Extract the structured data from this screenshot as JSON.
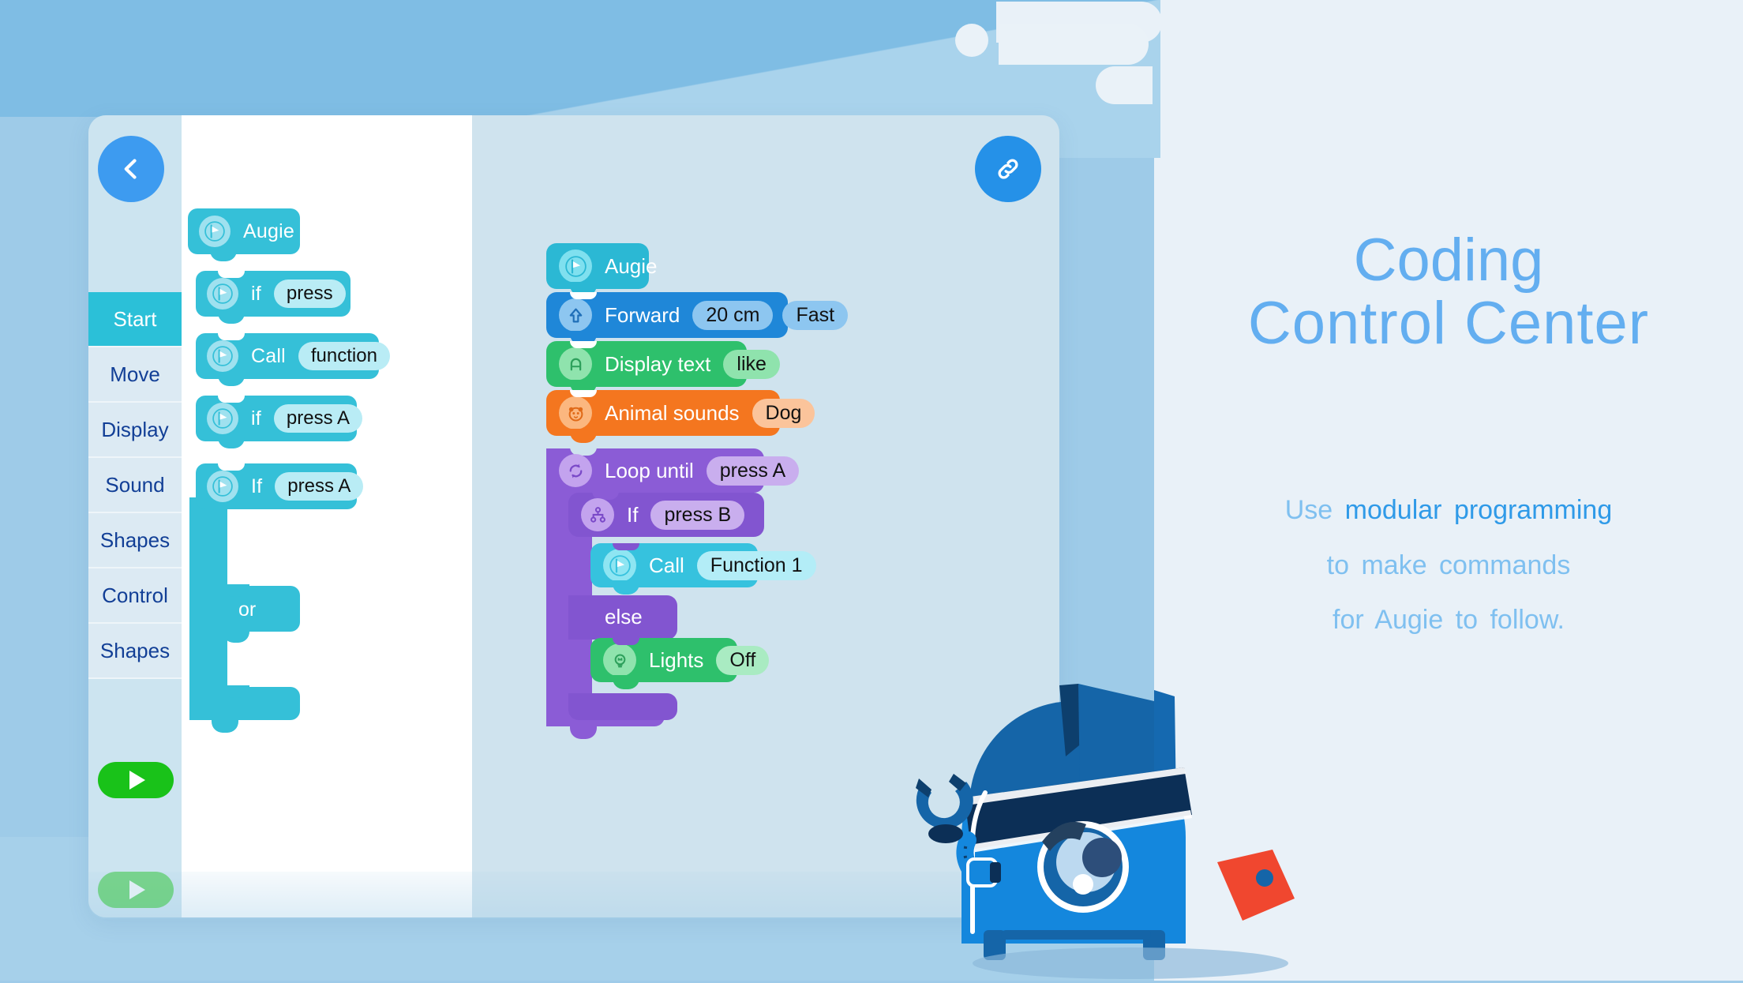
{
  "app": {
    "back_icon": "chevron-left-icon",
    "link_icon": "link-chain-icon",
    "run_icon": "play-icon"
  },
  "sidebar": {
    "items": [
      {
        "label": "Start",
        "active": true
      },
      {
        "label": "Move",
        "active": false
      },
      {
        "label": "Display",
        "active": false
      },
      {
        "label": "Sound",
        "active": false
      },
      {
        "label": "Shapes",
        "active": false
      },
      {
        "label": "Control",
        "active": false
      },
      {
        "label": "Shapes",
        "active": false
      }
    ]
  },
  "palette": {
    "blocks": [
      {
        "icon": "flag-icon",
        "label": "Augie",
        "pill": ""
      },
      {
        "icon": "flag-icon",
        "label": "if",
        "pill": "press"
      },
      {
        "icon": "flag-icon",
        "label": "Call",
        "pill": "function"
      },
      {
        "icon": "flag-icon",
        "label": "if",
        "pill": "press A"
      },
      {
        "icon": "flag-icon",
        "label": "If",
        "pill": "press A"
      }
    ],
    "c_block": {
      "operator": "or"
    }
  },
  "canvas": {
    "blocks": [
      {
        "icon": "flag-icon",
        "label": "Augie",
        "pills": [],
        "color": "#2bb8d4"
      },
      {
        "icon": "arrow-up-icon",
        "label": "Forward",
        "pills": [
          "20 cm",
          "Fast"
        ],
        "color": "#1f87d8"
      },
      {
        "icon": "display-icon",
        "label": "Display text",
        "pills": [
          "like"
        ],
        "color": "#2ec06c"
      },
      {
        "icon": "animal-face-icon",
        "label": "Animal sounds",
        "pills": [
          "Dog"
        ],
        "color": "#f4761f"
      },
      {
        "icon": "loop-icon",
        "label": "Loop until",
        "pills": [
          "press A"
        ],
        "color": "#8b5cd6"
      },
      {
        "icon": "branch-icon",
        "label": "If",
        "pills": [
          "press B"
        ],
        "color": "#8b5cd6"
      },
      {
        "icon": "flag-icon",
        "label": "Call",
        "pills": [
          "Function 1"
        ],
        "color": "#36c2de"
      },
      {
        "icon": "bulb-icon",
        "label": "Lights",
        "pills": [
          "Off"
        ],
        "color": "#2ec06c"
      }
    ],
    "else_label": "else"
  },
  "marketing": {
    "headline_line1": "Coding",
    "headline_line2": "Control  Center",
    "body_line1_a": "Use ",
    "body_line1_b": "modular  programming",
    "body_line2": "to  make  commands",
    "body_line3": "for  Augie  to  follow."
  },
  "colors": {
    "accent_blue": "#3d9bf0",
    "headline_blue": "#63aef0",
    "body_blue": "#7fc0f0",
    "body_strong_blue": "#2f9ae8",
    "sidebar_active": "#2bc0d8",
    "run_green": "#19c219",
    "block_start": "#2bb8d4",
    "block_move": "#1f87d8",
    "block_display": "#2ec06c",
    "block_sound": "#f4761f",
    "block_control": "#8b5cd6",
    "block_call": "#36c2de",
    "page_bg_left": "#9ecbe8",
    "page_bg_right": "#e9f1f8"
  }
}
